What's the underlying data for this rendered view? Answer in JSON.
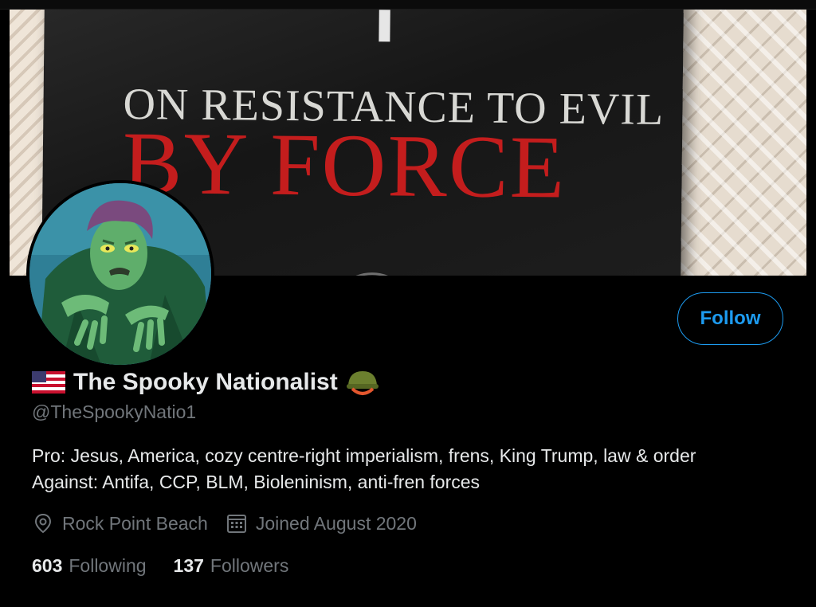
{
  "banner": {
    "book_line1": "ON RESISTANCE TO EVIL",
    "book_line2": "BY FORCE"
  },
  "profile": {
    "display_name": "The Spooky Nationalist",
    "name_prefix_icon": "us-flag-icon",
    "name_suffix_icon": "military-helmet-icon",
    "handle": "@TheSpookyNatio1",
    "bio_lines": [
      "Pro: Jesus, America, cozy centre-right imperialism, frens, King Trump, law & order",
      "Against: Antifa, CCP, BLM, Bioleninism, anti-fren forces"
    ],
    "location": "Rock Point Beach",
    "location_icon": "location-pin-icon",
    "joined": "Joined August 2020",
    "joined_icon": "calendar-icon"
  },
  "actions": {
    "follow_label": "Follow"
  },
  "stats": {
    "following_count": "603",
    "following_label": "Following",
    "followers_count": "137",
    "followers_label": "Followers"
  },
  "colors": {
    "background": "#000000",
    "text_primary": "#e7e9ea",
    "text_secondary": "#71767b",
    "accent": "#1d9bf0",
    "book_title_red": "#c41d1d"
  }
}
